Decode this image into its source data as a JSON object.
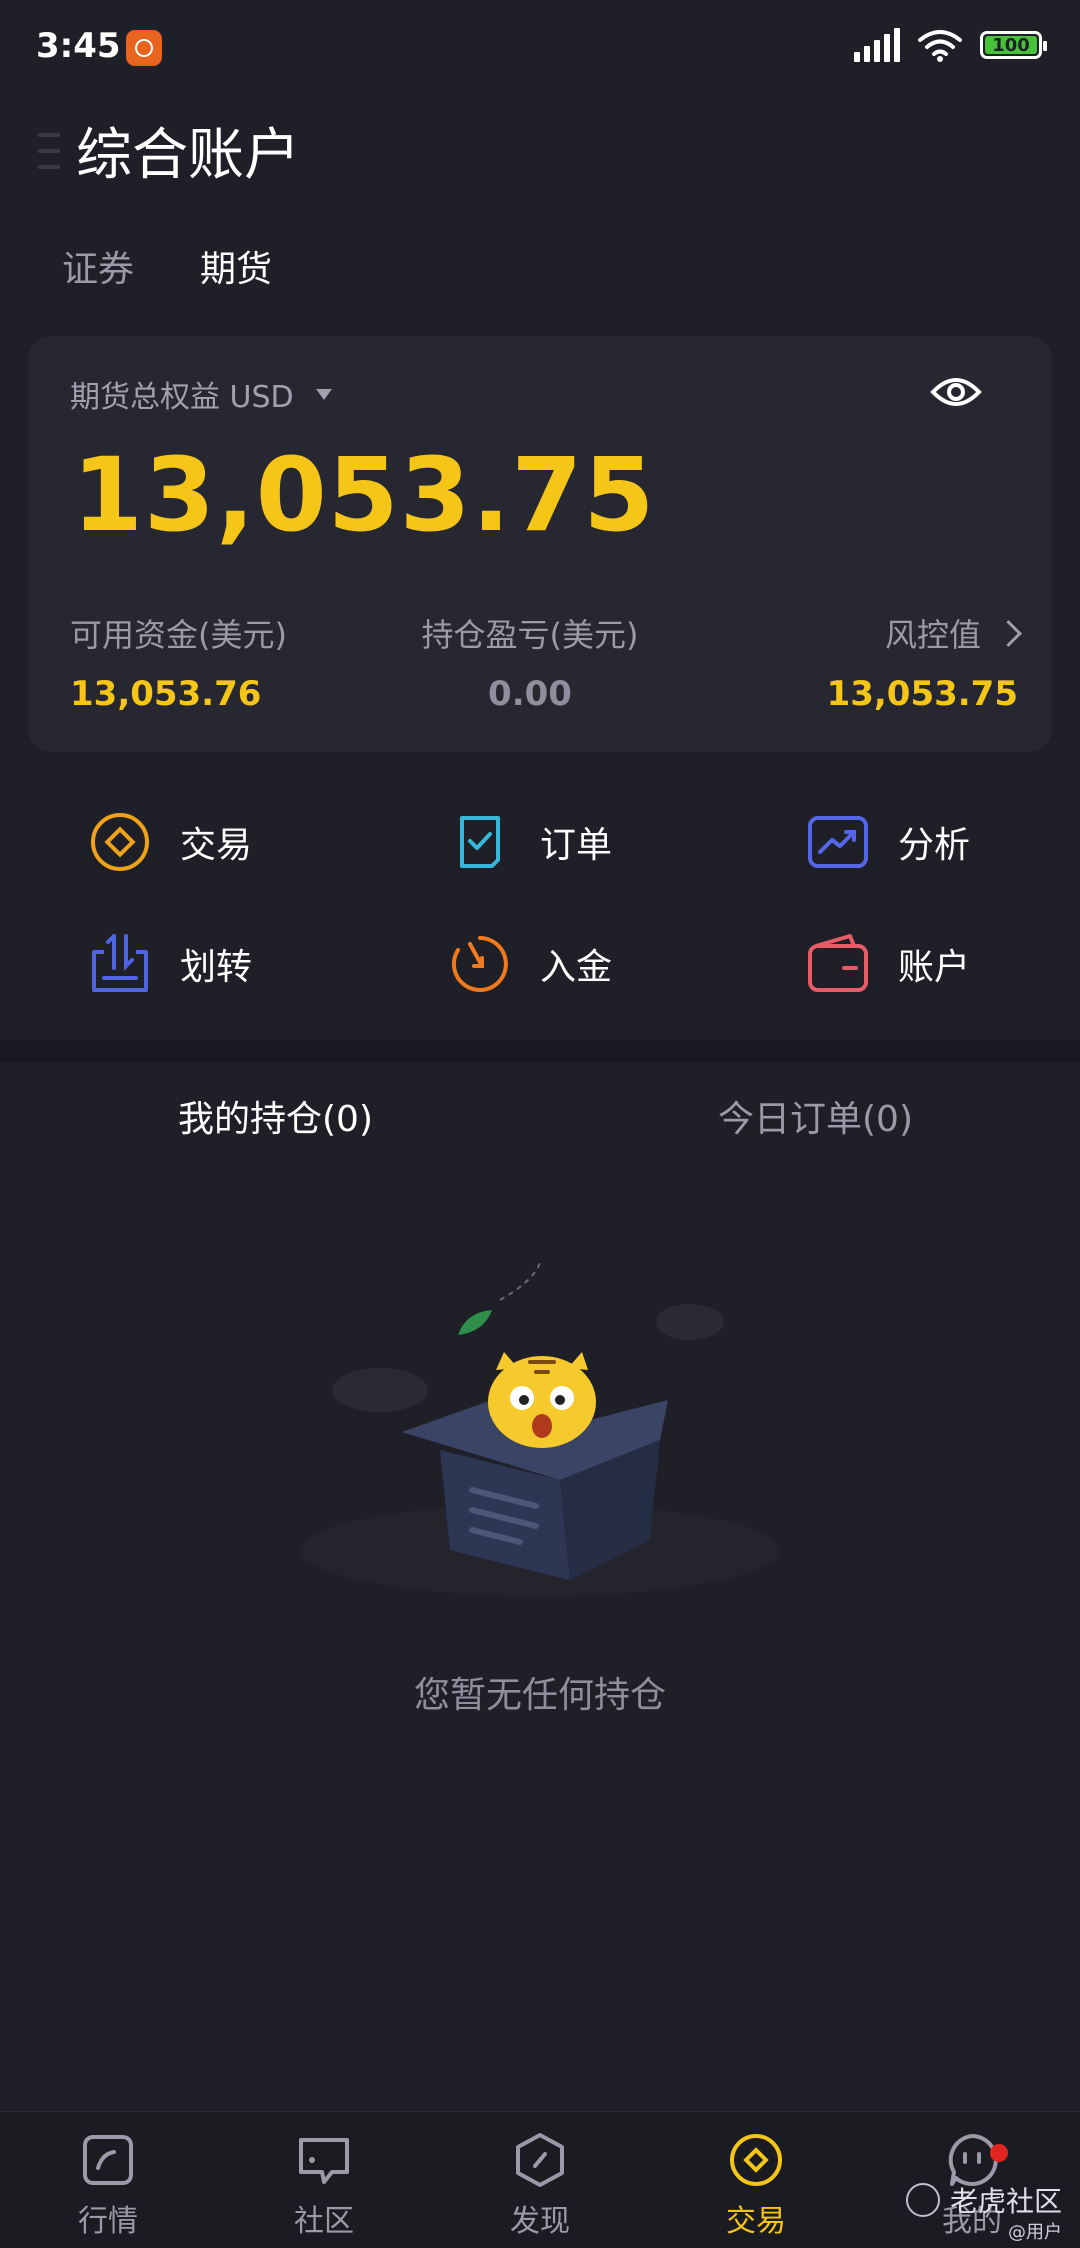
{
  "status_bar": {
    "time": "3:45",
    "battery": "100",
    "app_icon": "mi-app-icon"
  },
  "header": {
    "title": "综合账户",
    "menu_icon": "menu-icon"
  },
  "segment_tabs": [
    {
      "label": "证券"
    },
    {
      "label": "期货",
      "active": true
    }
  ],
  "equity": {
    "label": "期货总权益 USD",
    "value": "13,053.75",
    "metrics": [
      {
        "label": "可用资金(美元)",
        "value": "13,053.76"
      },
      {
        "label": "持仓盈亏(美元)",
        "value": "0.00"
      },
      {
        "label": "风控值",
        "value": "13,053.75"
      }
    ]
  },
  "actions": [
    {
      "label": "交易",
      "icon": "trade-icon",
      "color": "#f0a21a"
    },
    {
      "label": "订单",
      "icon": "order-icon",
      "color": "#35b8d9"
    },
    {
      "label": "分析",
      "icon": "analysis-icon",
      "color": "#5566e8"
    },
    {
      "label": "划转",
      "icon": "transfer-icon",
      "color": "#4f64e0"
    },
    {
      "label": "入金",
      "icon": "deposit-icon",
      "color": "#f07a1d"
    },
    {
      "label": "账户",
      "icon": "wallet-icon",
      "color": "#e85c68"
    }
  ],
  "positions": {
    "tabs": [
      {
        "label": "我的持仓(0)",
        "active": true
      },
      {
        "label": "今日订单(0)"
      }
    ],
    "empty_text": "您暂无任何持仓"
  },
  "bottom_nav": [
    {
      "label": "行情",
      "icon": "market-icon"
    },
    {
      "label": "社区",
      "icon": "community-icon"
    },
    {
      "label": "发现",
      "icon": "discover-icon"
    },
    {
      "label": "交易",
      "icon": "trade-nav-icon",
      "active": true
    },
    {
      "label": "我的",
      "icon": "profile-icon",
      "badge": true
    }
  ],
  "watermark": {
    "main": "老虎社区",
    "sub": "@用户"
  },
  "colors": {
    "accent": "#f5c518",
    "background": "#1f1f27",
    "card": "#272731"
  }
}
